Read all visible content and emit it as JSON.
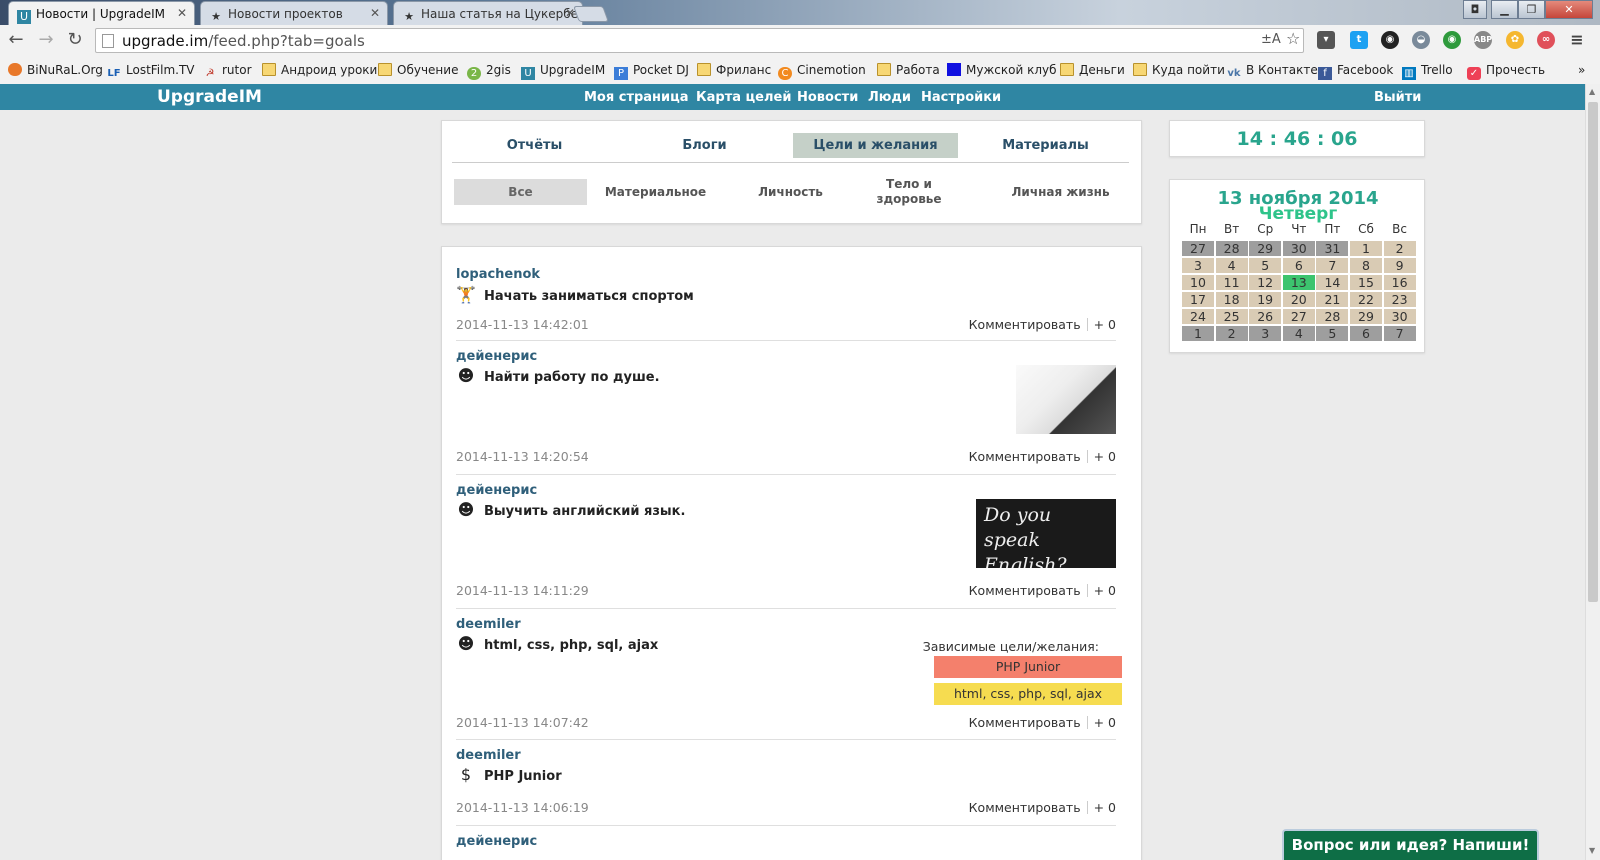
{
  "browser": {
    "tabs": [
      {
        "title": "Новости | UpgradeIM",
        "icon": "upgradeim-favicon"
      },
      {
        "title": "Новости проектов",
        "icon": "star-icon"
      },
      {
        "title": "Наша статья на Цукербе",
        "icon": "star-icon"
      }
    ],
    "url_host": "upgrade.im",
    "url_path": "/feed.php?tab=goals",
    "bookmarks": [
      {
        "label": "BiNuRaL.Org",
        "icon": "firefox-icon"
      },
      {
        "label": "LostFilm.TV",
        "icon": "lf-icon"
      },
      {
        "label": "rutor",
        "icon": "rutor-icon"
      },
      {
        "label": "Андроид уроки",
        "icon": "folder-icon"
      },
      {
        "label": "Обучение",
        "icon": "folder-icon"
      },
      {
        "label": "2gis",
        "icon": "2gis-icon"
      },
      {
        "label": "UpgradeIM",
        "icon": "upgradeim-icon"
      },
      {
        "label": "Pocket DJ",
        "icon": "pocketdj-icon"
      },
      {
        "label": "Фриланс",
        "icon": "folder-icon"
      },
      {
        "label": "Cinemotion",
        "icon": "cinemotion-icon"
      },
      {
        "label": "Работа",
        "icon": "folder-icon"
      },
      {
        "label": "Мужской клуб",
        "icon": "blue-square-icon"
      },
      {
        "label": "Деньги",
        "icon": "folder-icon"
      },
      {
        "label": "Куда пойти",
        "icon": "folder-icon"
      },
      {
        "label": "В Контакте",
        "icon": "vk-icon"
      },
      {
        "label": "Facebook",
        "icon": "facebook-icon"
      },
      {
        "label": "Trello",
        "icon": "trello-icon"
      },
      {
        "label": "Прочесть",
        "icon": "pocket-icon"
      }
    ],
    "bookmarks_more": "»"
  },
  "site": {
    "brand": "UpgradeIM",
    "menu": [
      "Моя страница",
      "Карта целей",
      "Новости",
      "Люди",
      "Настройки"
    ],
    "logout": "Выйти"
  },
  "feed": {
    "tabs": [
      "Отчёты",
      "Блоги",
      "Цели и желания",
      "Материалы"
    ],
    "selected_tab": "Цели и желания",
    "subtabs": [
      "Все",
      "Материальное",
      "Личность",
      "Тело и здоровье",
      "Личная жизнь"
    ],
    "selected_subtab": "Все",
    "comment_label": "Комментировать",
    "plus_label": "+ 0",
    "posts": [
      {
        "author": "lopachenok",
        "icon": "sport-icon",
        "goal": "Начать заниматься спортом",
        "date": "2014-11-13 14:42:01"
      },
      {
        "author": "дейенерис",
        "icon": "head-gear-icon",
        "goal": "Найти работу по душе.",
        "date": "2014-11-13 14:20:54",
        "image": "office-woman-image"
      },
      {
        "author": "дейенерис",
        "icon": "head-gear-icon",
        "goal": "Выучить английский язык.",
        "date": "2014-11-13 14:11:29",
        "image": "do-you-speak-english-image",
        "image_text": "Do you speak English?"
      },
      {
        "author": "deemiler",
        "icon": "head-gear-icon",
        "goal": "html, css, php, sql, ajax",
        "date": "2014-11-13 14:07:42",
        "dependent_label": "Зависимые цели/желания:",
        "dependent": [
          {
            "label": "PHP Junior",
            "color": "#f4806c"
          },
          {
            "label": "html, css, php, sql, ajax",
            "color": "#f6dc50"
          }
        ]
      },
      {
        "author": "deemiler",
        "icon": "money-bag-icon",
        "goal": "PHP Junior",
        "date": "2014-11-13 14:06:19"
      },
      {
        "author": "дейенерис"
      }
    ]
  },
  "clock": "14 : 46 : 06",
  "calendar": {
    "date": "13 ноября 2014",
    "weekday": "Четверг",
    "headers": [
      "Пн",
      "Вт",
      "Ср",
      "Чт",
      "Пт",
      "Сб",
      "Вс"
    ],
    "weeks": [
      [
        "27",
        "28",
        "29",
        "30",
        "31",
        "1",
        "2"
      ],
      [
        "3",
        "4",
        "5",
        "6",
        "7",
        "8",
        "9"
      ],
      [
        "10",
        "11",
        "12",
        "13",
        "14",
        "15",
        "16"
      ],
      [
        "17",
        "18",
        "19",
        "20",
        "21",
        "22",
        "23"
      ],
      [
        "24",
        "25",
        "26",
        "27",
        "28",
        "29",
        "30"
      ],
      [
        "1",
        "2",
        "3",
        "4",
        "5",
        "6",
        "7"
      ]
    ],
    "today": "13",
    "colors": {
      "outside": "#9e9e9e",
      "inside": "#d9cbb4",
      "today": "#3cc46e"
    }
  },
  "feedback_button": "Вопрос или идея? Напиши!"
}
